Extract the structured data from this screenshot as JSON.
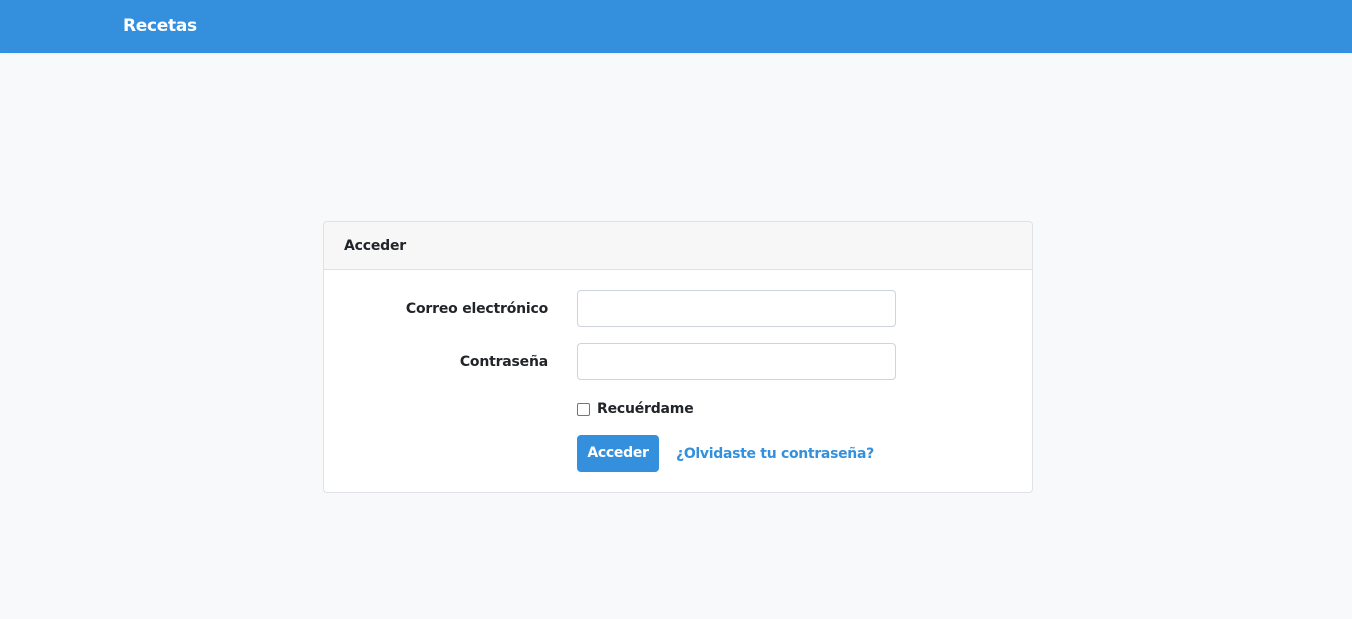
{
  "navbar": {
    "brand": "Recetas",
    "color": "#3490dc"
  },
  "login_card": {
    "header_title": "Acceder",
    "email": {
      "label": "Correo electrónico",
      "value": ""
    },
    "password": {
      "label": "Contraseña",
      "value": ""
    },
    "remember": {
      "label": "Recuérdame",
      "checked": false
    },
    "submit_label": "Acceder",
    "forgot_link": "¿Olvidaste tu contraseña?"
  },
  "colors": {
    "primary": "#3490dc",
    "page_background": "#f8f9fa",
    "card_header_background": "#f7f7f7"
  }
}
